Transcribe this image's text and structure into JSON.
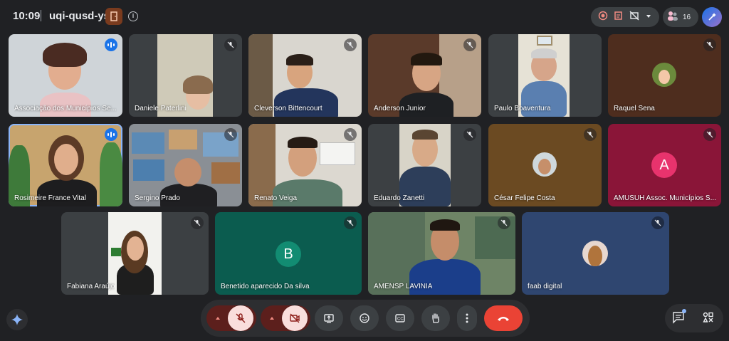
{
  "header": {
    "time": "10:09",
    "meeting_code": "uqi-qusd-ysj",
    "participant_count": "16"
  },
  "tiles": [
    {
      "name": "Associação dos Municípios Se...",
      "mic": "active"
    },
    {
      "name": "Daniele Paterlini",
      "mic": "muted"
    },
    {
      "name": "Cleverson Bittencourt",
      "mic": "muted"
    },
    {
      "name": "Anderson Junior",
      "mic": "muted"
    },
    {
      "name": "Paulo Boaventura",
      "mic": "muted"
    },
    {
      "name": "Raquel Sena",
      "mic": "muted"
    },
    {
      "name": "Rosimeire France Vital",
      "mic": "active"
    },
    {
      "name": "Sergino Prado",
      "mic": "muted"
    },
    {
      "name": "Renato Veiga",
      "mic": "muted"
    },
    {
      "name": "Eduardo Zanetti",
      "mic": "muted"
    },
    {
      "name": "César Felipe Costa",
      "mic": "muted"
    },
    {
      "name": "AMUSUH Assoc. Municípios S...",
      "mic": "muted",
      "initial": "A"
    },
    {
      "name": "Fabiana Araújo",
      "mic": "muted"
    },
    {
      "name": "Benetido aparecido Da silva",
      "mic": "muted",
      "initial": "B"
    },
    {
      "name": "AMENSP LAVINIA",
      "mic": "muted"
    },
    {
      "name": "faab digital",
      "mic": "muted"
    }
  ],
  "colors": {
    "background": "#202124",
    "tile": "#3c4043",
    "speaking_outline": "#8ab4f8",
    "hangup": "#ea4335",
    "amusuh_tile": "#8a1538",
    "amusuh_avatar": "#e8336d",
    "benetido_tile": "#0b5c4f",
    "benetido_avatar": "#128c72",
    "faab_tile": "#2f4670"
  },
  "icons": {
    "meeting_code_door": "door-icon",
    "info": "info-icon",
    "record": "record-icon",
    "edit_notes": "notes-icon",
    "screen_off": "presentation-off-icon",
    "chevron": "chevron-down-icon",
    "people": "people-icon",
    "ai": "ai-magic-icon",
    "gemini": "gemini-icon",
    "mic_off": "mic-off-icon",
    "cam_off": "camera-off-icon",
    "present": "present-screen-icon",
    "emoji": "emoji-icon",
    "captions": "captions-icon",
    "raise_hand": "raise-hand-icon",
    "more": "more-vert-icon",
    "hangup": "hangup-icon",
    "chat": "chat-icon",
    "activities": "activities-icon"
  }
}
